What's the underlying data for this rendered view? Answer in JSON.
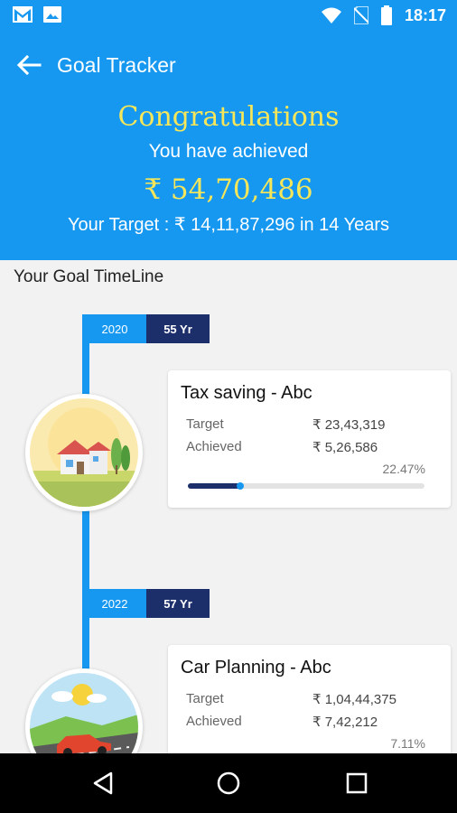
{
  "status_bar": {
    "time": "18:17",
    "icons": [
      "gmail-icon",
      "image-icon",
      "wifi-icon",
      "no-sim-icon",
      "battery-icon"
    ]
  },
  "header": {
    "title": "Goal Tracker",
    "congrats": "Congratulations",
    "achieved_label": "You have achieved",
    "achieved_amount": "₹ 54,70,486",
    "target_line": "Your Target : ₹ 14,11,87,296 in 14 Years"
  },
  "timeline": {
    "title": "Your Goal TimeLine",
    "goals": [
      {
        "year": "2020",
        "age": "55 Yr",
        "name": "Tax  saving - Abc",
        "target_label": "Target",
        "target_value": "₹ 23,43,319",
        "achieved_label": "Achieved",
        "achieved_value": "₹ 5,26,586",
        "percent": "22.47%",
        "progress": 0.2247,
        "image": "house-icon"
      },
      {
        "year": "2022",
        "age": "57 Yr",
        "name": "Car Planning - Abc",
        "target_label": "Target",
        "target_value": "₹ 1,04,44,375",
        "achieved_label": "Achieved",
        "achieved_value": "₹ 7,42,212",
        "percent": "7.11%",
        "progress": 0.0711,
        "image": "car-icon"
      }
    ]
  },
  "nav": {
    "buttons": [
      "back-nav-icon",
      "home-nav-icon",
      "recents-nav-icon"
    ]
  },
  "colors": {
    "primary": "#1798f0",
    "dark": "#1c2f6b",
    "highlight": "#f5e65a"
  }
}
